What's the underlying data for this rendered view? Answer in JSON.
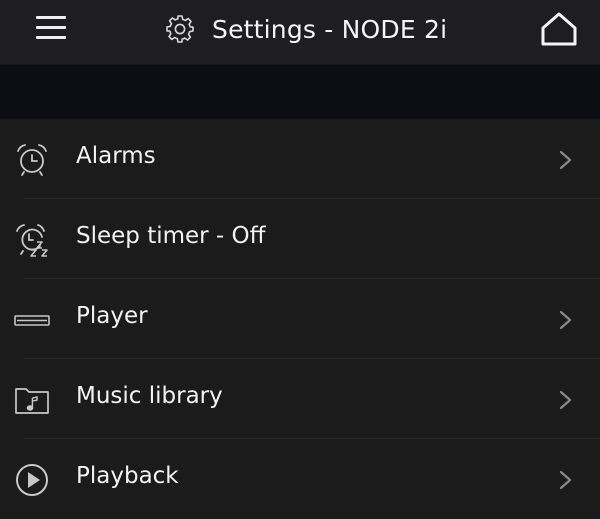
{
  "header": {
    "title": "Settings - NODE 2i",
    "menu_icon": "hamburger-icon",
    "title_icon": "gear-icon",
    "home_icon": "home-icon"
  },
  "settings": {
    "items": [
      {
        "label": "Alarms",
        "icon": "alarm-clock-icon",
        "has_chevron": true
      },
      {
        "label": "Sleep timer - Off",
        "icon": "sleep-timer-icon",
        "has_chevron": false
      },
      {
        "label": "Player",
        "icon": "player-device-icon",
        "has_chevron": true
      },
      {
        "label": "Music library",
        "icon": "music-folder-icon",
        "has_chevron": true
      },
      {
        "label": "Playback",
        "icon": "play-circle-icon",
        "has_chevron": true
      }
    ]
  },
  "colors": {
    "background": "#1b1b1c",
    "topbar": "#1e1e20",
    "band": "#0c0e14",
    "text": "#f2f2f2",
    "icon": "#c8c8c8",
    "chevron": "#8a8a8a",
    "divider": "#2c2c2e"
  }
}
